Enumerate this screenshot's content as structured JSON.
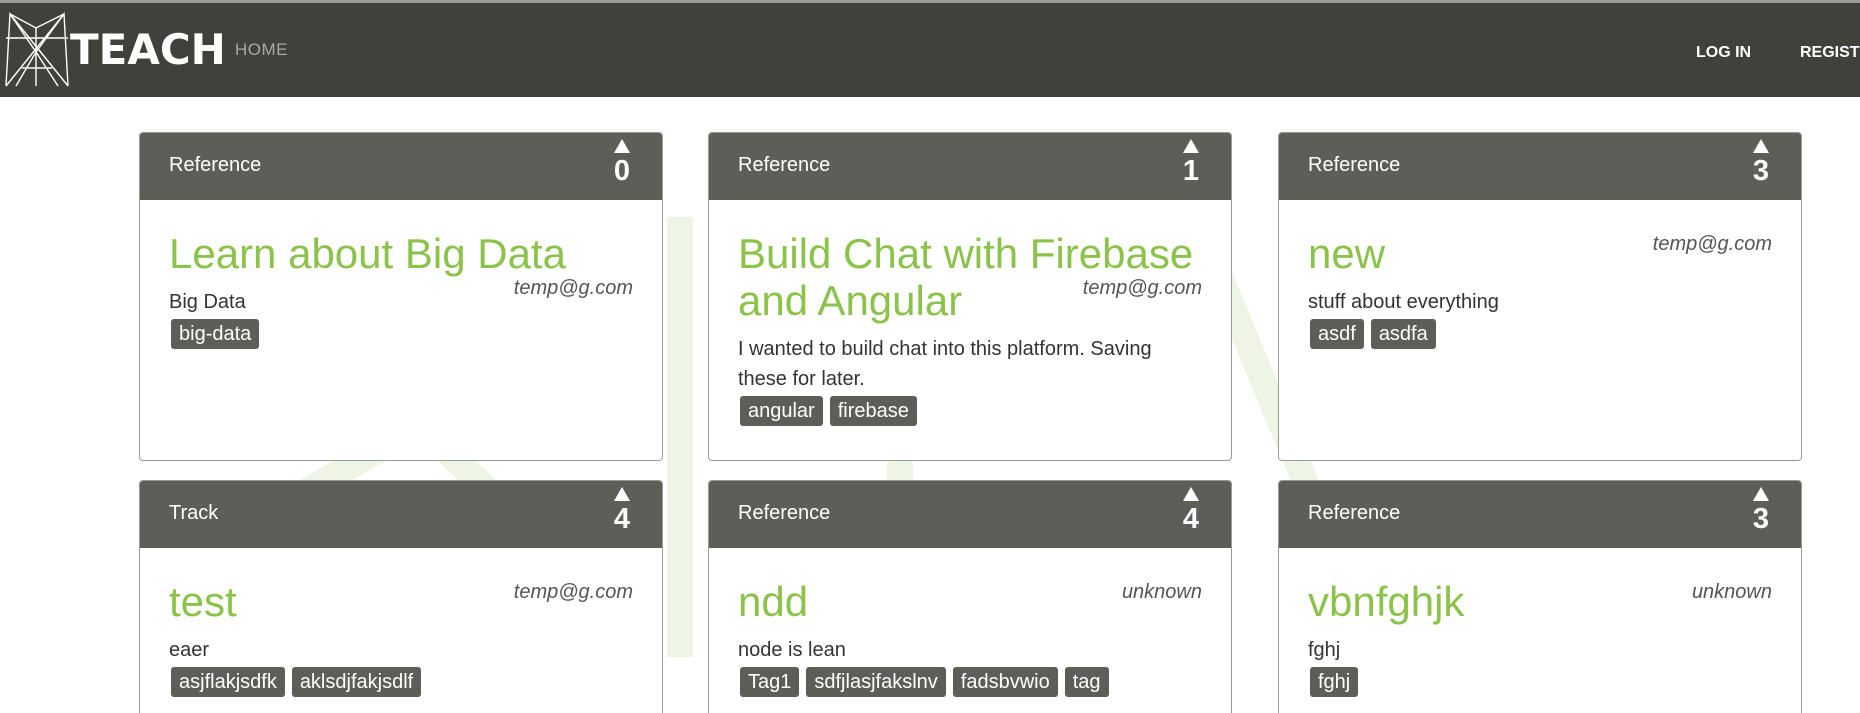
{
  "nav": {
    "brand": "TEACH",
    "home": "HOME",
    "login": "LOG IN",
    "register": "REGISTER"
  },
  "cards": [
    {
      "type": "Reference",
      "votes": "0",
      "title_lines": [
        "Learn about Big Data"
      ],
      "author": "temp@g.com",
      "description": "Big Data",
      "tags": [
        "big-data"
      ]
    },
    {
      "type": "Reference",
      "votes": "1",
      "title_lines": [
        "Build Chat with Firebase",
        "and Angular"
      ],
      "author": "temp@g.com",
      "description": "I wanted to build chat into this platform. Saving these for later.",
      "tags": [
        "angular",
        "firebase"
      ]
    },
    {
      "type": "Reference",
      "votes": "3",
      "title_lines": [
        "new"
      ],
      "author": "temp@g.com",
      "description": "stuff about everything",
      "tags": [
        "asdf",
        "asdfa"
      ]
    },
    {
      "type": "Track",
      "votes": "4",
      "title_lines": [
        "test"
      ],
      "author": "temp@g.com",
      "description": "eaer",
      "tags": [
        "asjflakjsdfk",
        "aklsdjfakjsdlf"
      ]
    },
    {
      "type": "Reference",
      "votes": "4",
      "title_lines": [
        "ndd"
      ],
      "author": "unknown",
      "description": "node is lean",
      "tags": [
        "Tag1",
        "sdfjlasjfakslnv",
        "fadsbvwio",
        "tag"
      ]
    },
    {
      "type": "Reference",
      "votes": "3",
      "title_lines": [
        "vbnfghjk"
      ],
      "author": "unknown",
      "description": "fghj",
      "tags": [
        "fghj"
      ]
    }
  ]
}
